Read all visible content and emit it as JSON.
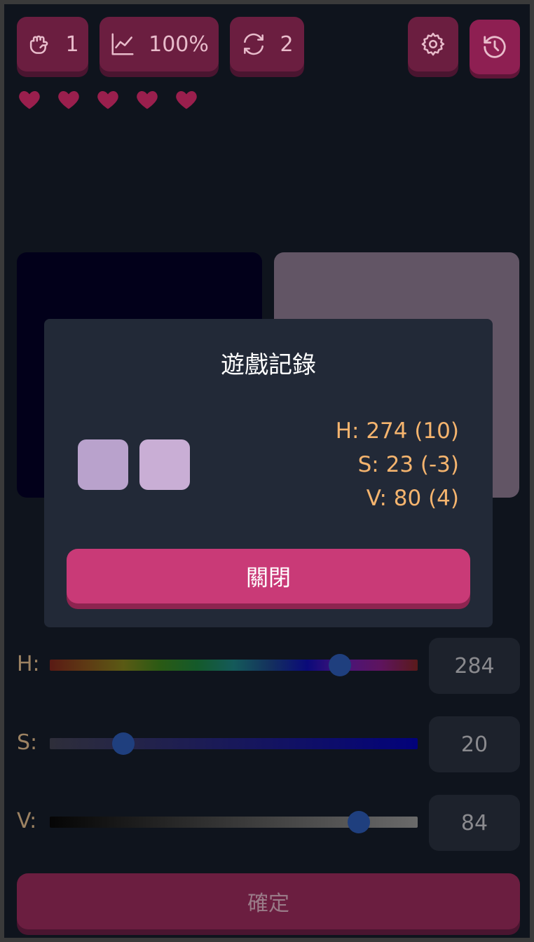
{
  "toolbar": {
    "punch_count": "1",
    "accuracy": "100%",
    "refresh_count": "2",
    "icons": [
      "fist-icon",
      "chart-line-icon",
      "refresh-icon",
      "gear-icon",
      "history-icon"
    ],
    "accent": "#6b1e40"
  },
  "lives": {
    "count": 5,
    "color": "#9a1f4d"
  },
  "swatches": {
    "target_color": "#02001a",
    "current_color": "#625565"
  },
  "sliders": [
    {
      "label": "H:",
      "value": "284",
      "level": 284,
      "max": 360
    },
    {
      "label": "S:",
      "value": "20",
      "level": 20,
      "max": 100
    },
    {
      "label": "V:",
      "value": "84",
      "level": 84,
      "max": 100
    }
  ],
  "confirm_label": "確定",
  "modal": {
    "title": "遊戲記錄",
    "target_color": "#b9a2cc",
    "guess_color": "#c9aed5",
    "stats": {
      "h": "H: 274 (10)",
      "s": "S: 23 (-3)",
      "v": "V: 80 (4)"
    },
    "close_label": "關閉"
  }
}
